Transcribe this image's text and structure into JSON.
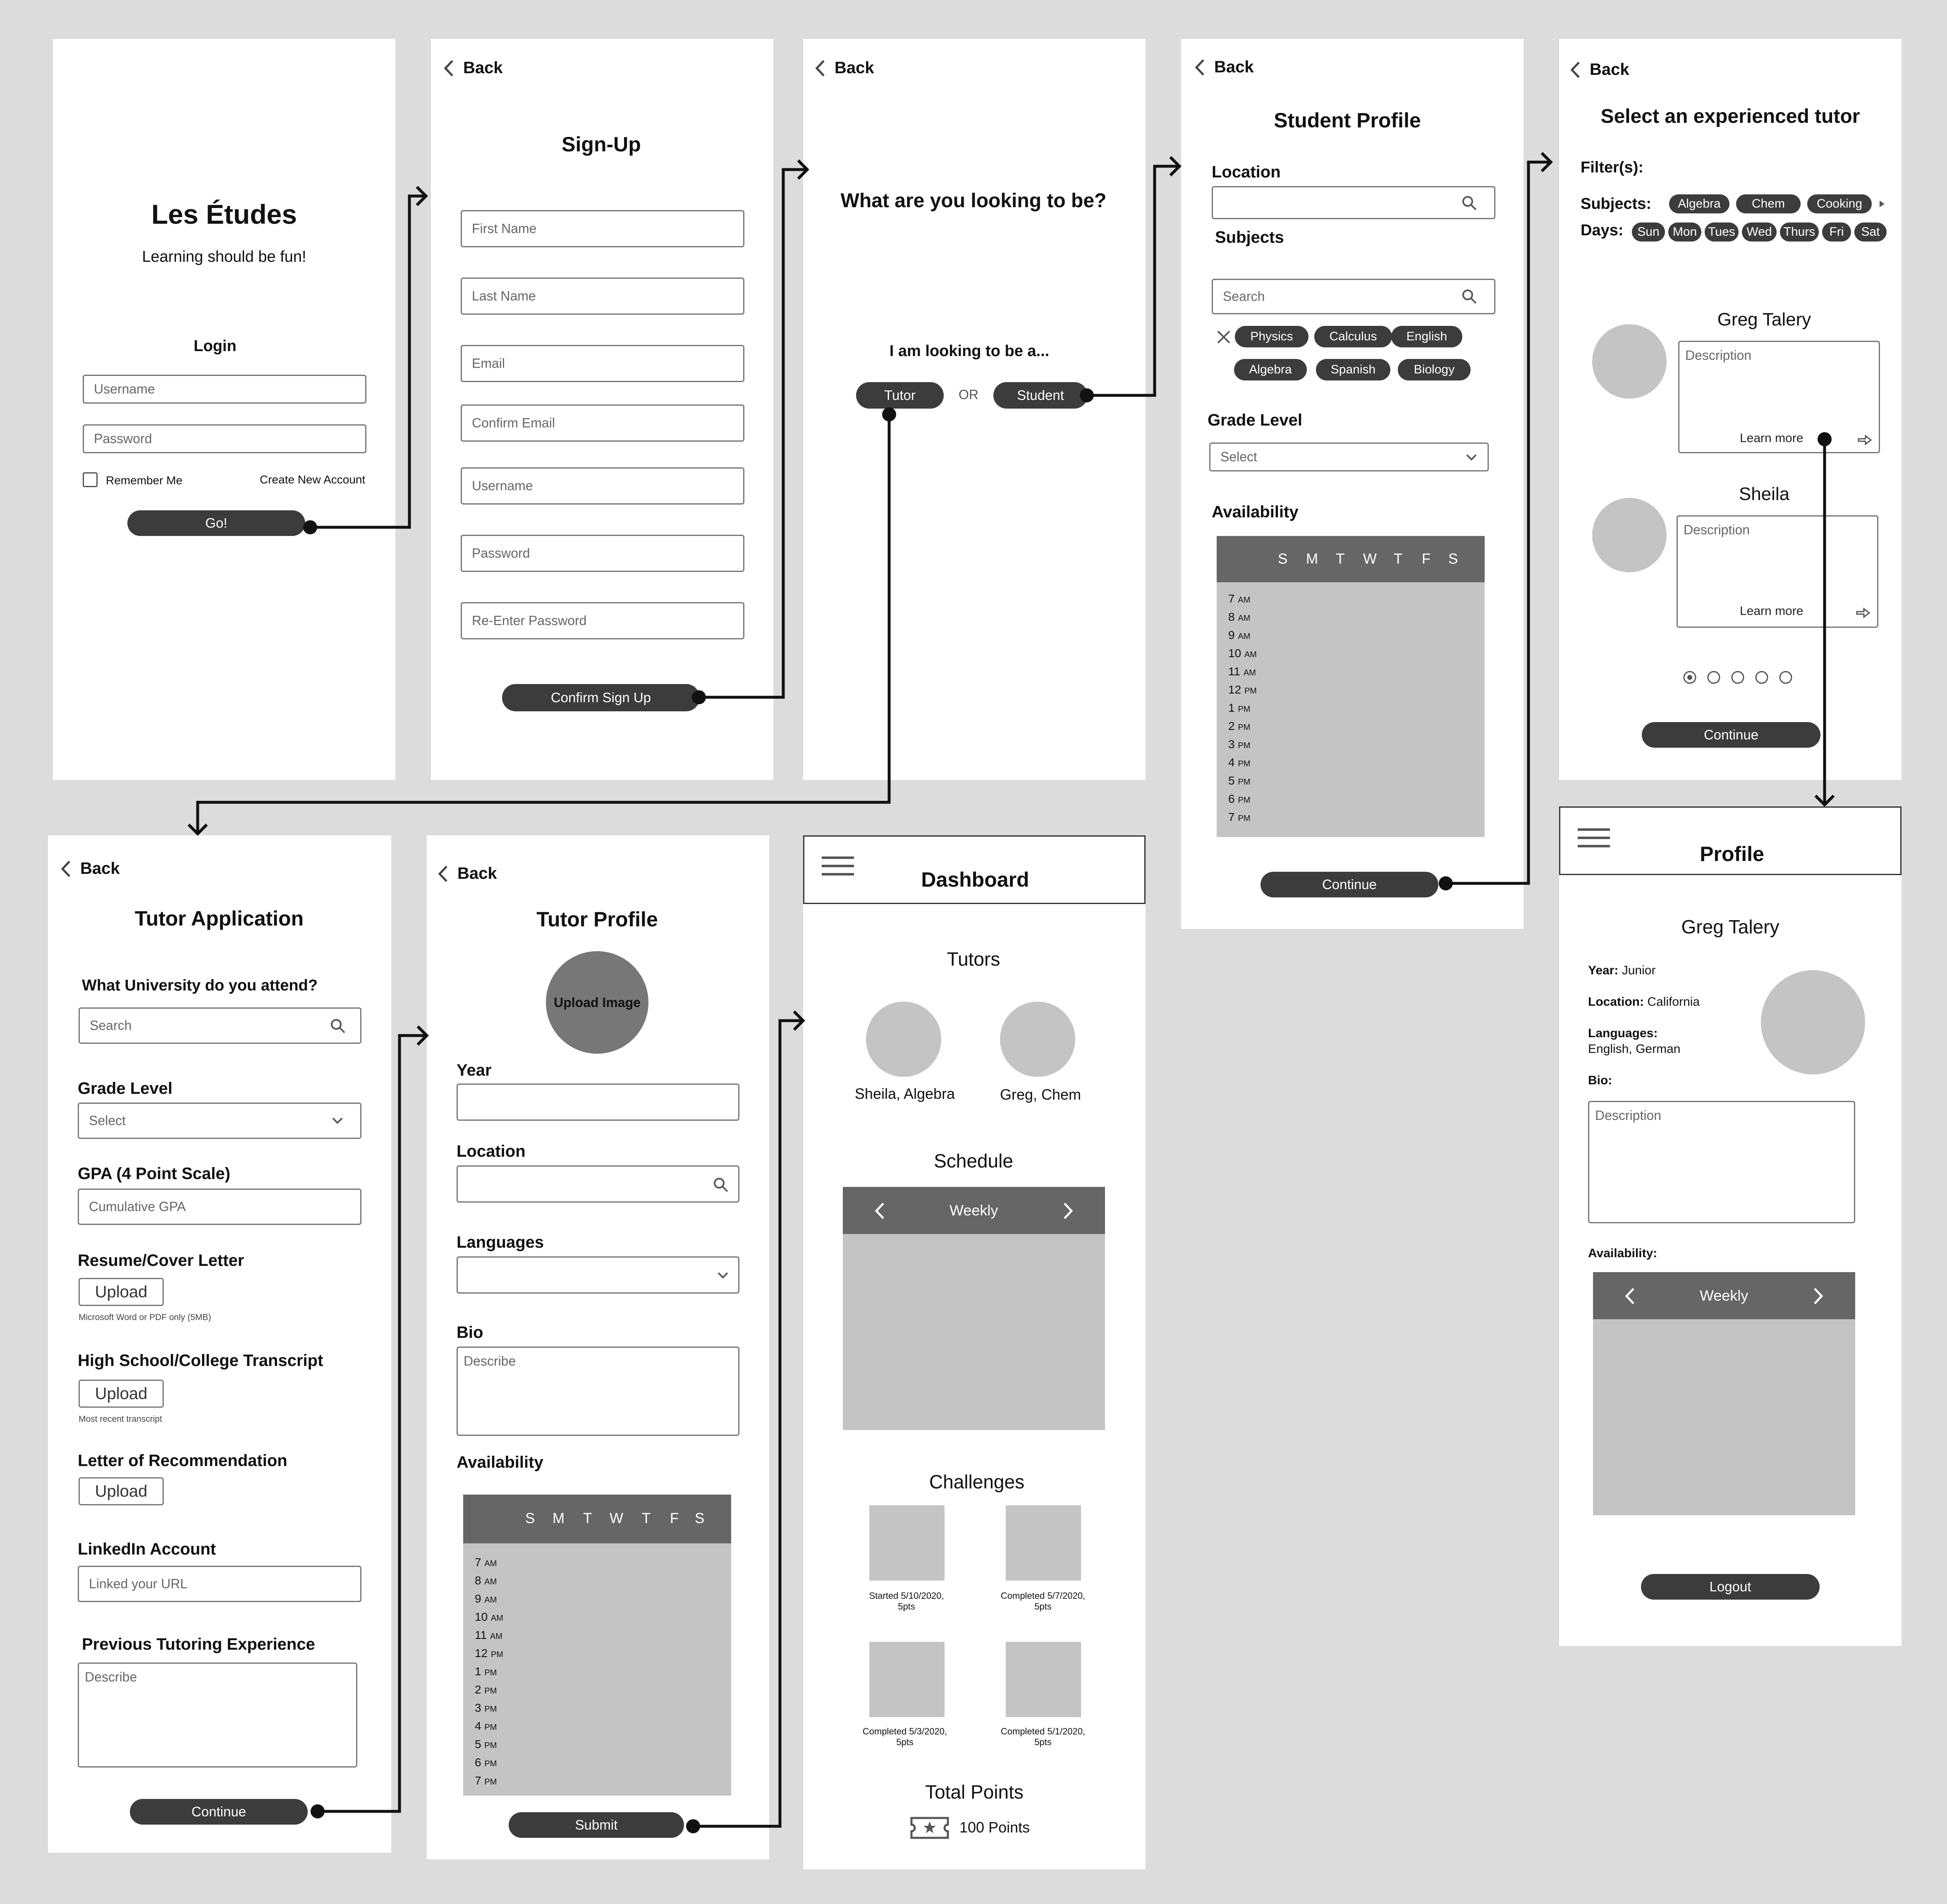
{
  "common": {
    "back": "Back",
    "search": "Search",
    "select": "Select",
    "description": "Description",
    "describe": "Describe",
    "upload": "Upload",
    "continue": "Continue",
    "learn_more": "Learn more",
    "weekly": "Weekly"
  },
  "login": {
    "app_title": "Les Études",
    "tagline": "Learning should be fun!",
    "login_heading": "Login",
    "username_ph": "Username",
    "password_ph": "Password",
    "remember_me": "Remember Me",
    "create_account": "Create New Account",
    "go_button": "Go!"
  },
  "signup": {
    "title": "Sign-Up",
    "fields": [
      "First Name",
      "Last Name",
      "Email",
      "Confirm Email",
      "Username",
      "Password",
      "Re-Enter Password"
    ],
    "confirm_button": "Confirm Sign Up"
  },
  "role": {
    "question": "What are you looking to be?",
    "prompt": "I am looking to be a...",
    "tutor_button": "Tutor",
    "or_text": "OR",
    "student_button": "Student"
  },
  "student_profile": {
    "title": "Student Profile",
    "location_label": "Location",
    "subjects_label": "Subjects",
    "subject_chips": [
      "Physics",
      "Calculus",
      "English",
      "Algebra",
      "Spanish",
      "Biology"
    ],
    "grade_label": "Grade Level",
    "availability_label": "Availability"
  },
  "availability": {
    "days": [
      "S",
      "M",
      "T",
      "W",
      "T",
      "F",
      "S"
    ],
    "times": [
      {
        "h": "7",
        "p": "AM"
      },
      {
        "h": "8",
        "p": "AM"
      },
      {
        "h": "9",
        "p": "AM"
      },
      {
        "h": "10",
        "p": "AM"
      },
      {
        "h": "11",
        "p": "AM"
      },
      {
        "h": "12",
        "p": "PM"
      },
      {
        "h": "1",
        "p": "PM"
      },
      {
        "h": "2",
        "p": "PM"
      },
      {
        "h": "3",
        "p": "PM"
      },
      {
        "h": "4",
        "p": "PM"
      },
      {
        "h": "5",
        "p": "PM"
      },
      {
        "h": "6",
        "p": "PM"
      },
      {
        "h": "7",
        "p": "PM"
      }
    ]
  },
  "select_tutor": {
    "title": "Select an experienced tutor",
    "filters_label": "Filter(s):",
    "subjects_label": "Subjects:",
    "subject_chips": [
      "Algebra",
      "Chem",
      "Cooking"
    ],
    "days_label": "Days:",
    "day_chips": [
      "Sun",
      "Mon",
      "Tues",
      "Wed",
      "Thurs",
      "Fri",
      "Sat"
    ],
    "tutors": [
      {
        "name": "Greg Talery"
      },
      {
        "name": "Sheila"
      }
    ]
  },
  "tutor_app": {
    "title": "Tutor Application",
    "university_q": "What University do you attend?",
    "grade_label": "Grade Level",
    "gpa_label": "GPA (4 Point Scale)",
    "gpa_ph": "Cumulative GPA",
    "resume_label": "Resume/Cover Letter",
    "resume_note": "Microsoft Word or PDF only (5MB)",
    "transcript_label": "High School/College Transcript",
    "transcript_note": "Most recent transcript",
    "letter_label": "Letter of Recommendation",
    "linkedin_label": "LinkedIn Account",
    "linkedin_ph": "Linked your URL",
    "experience_label": "Previous Tutoring Experience"
  },
  "tutor_profile": {
    "title": "Tutor Profile",
    "upload_image": "Upload Image",
    "year_label": "Year",
    "location_label": "Location",
    "languages_label": "Languages",
    "bio_label": "Bio",
    "availability_label": "Availability",
    "submit_button": "Submit"
  },
  "dashboard": {
    "title": "Dashboard",
    "tutors_heading": "Tutors",
    "tutors": [
      {
        "label": "Sheila, Algebra"
      },
      {
        "label": "Greg, Chem"
      }
    ],
    "schedule_heading": "Schedule",
    "challenges_heading": "Challenges",
    "challenges": [
      {
        "l1": "Started 5/10/2020,",
        "l2": "5pts"
      },
      {
        "l1": "Completed 5/7/2020,",
        "l2": "5pts"
      },
      {
        "l1": "Completed 5/3/2020,",
        "l2": "5pts"
      },
      {
        "l1": "Completed 5/1/2020,",
        "l2": "5pts"
      }
    ],
    "total_heading": "Total Points",
    "points": "100 Points"
  },
  "profile": {
    "title": "Profile",
    "name": "Greg Talery",
    "year_label": "Year:",
    "year": "Junior",
    "location_label": "Location:",
    "location": "California",
    "languages_label": "Languages:",
    "languages": "English, German",
    "bio_label": "Bio:",
    "availability_label": "Availability:",
    "logout_button": "Logout"
  }
}
